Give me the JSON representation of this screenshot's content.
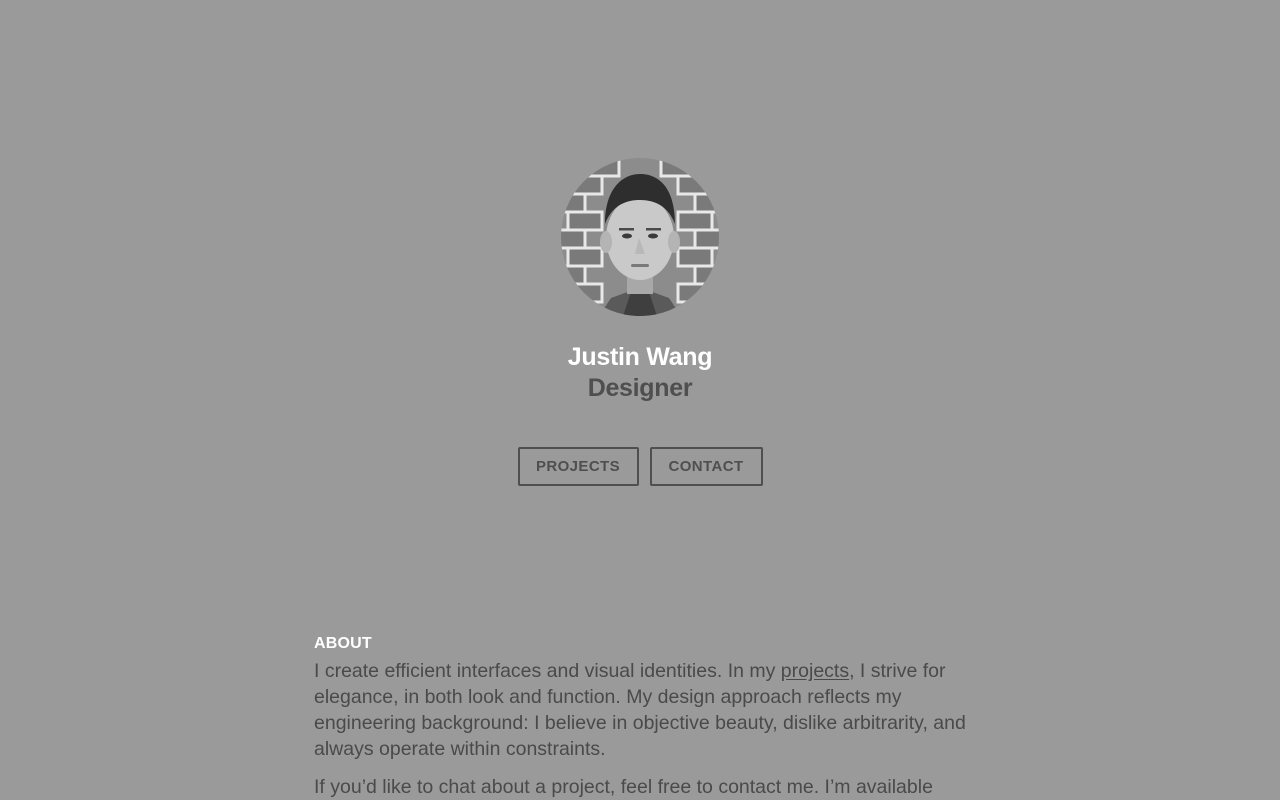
{
  "profile": {
    "name": "Justin Wang",
    "role": "Designer",
    "avatar_alt": "portrait-photo"
  },
  "nav": {
    "projects_label": "PROJECTS",
    "contact_label": "CONTACT"
  },
  "about": {
    "heading": "ABOUT",
    "p1_before": "I create efficient interfaces and visual identities. In my ",
    "p1_link": "projects",
    "p1_after": ", I strive for elegance, in both look and function. My design approach reflects my engineering background: I believe in objective beauty, dislike arbitrarity, and always operate within constraints.",
    "p2": "If you’d like to chat about a project, feel free to contact me. I’m available"
  },
  "colors": {
    "background": "#9a9a9a",
    "name": "#ffffff",
    "muted": "#4f4f4f"
  }
}
